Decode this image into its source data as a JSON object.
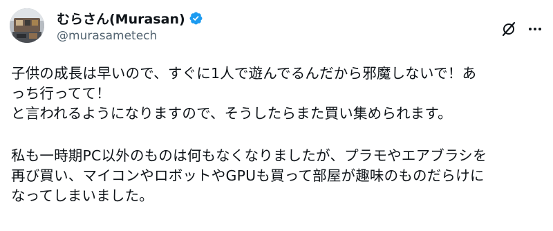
{
  "author": {
    "display_name": "むらさん(Murasan)",
    "handle": "@murasametech",
    "verified": true,
    "avatar_icon": "avatar-photo"
  },
  "actions": {
    "grok_icon": "grok-slash-icon",
    "more_icon": "more-dots-icon"
  },
  "colors": {
    "verified_blue": "#1d9bf0",
    "text_primary": "#0f1419",
    "text_secondary": "#536471"
  },
  "post": {
    "paragraph1": {
      "line1": "子供の成長は早いので、すぐに1人で遊んでるんだから邪魔しないで！あ",
      "line2": "っち行ってて！",
      "line3": "と言われるようになりますので、そうしたらまた買い集められます。"
    },
    "paragraph2": {
      "line1": "私も一時期PC以外のものは何もなくなりましたが、プラモやエアブラシを",
      "line2": "再び買い、マイコンやロボットやGPUも買って部屋が趣味のものだらけに",
      "line3": "なってしまいました。"
    }
  }
}
